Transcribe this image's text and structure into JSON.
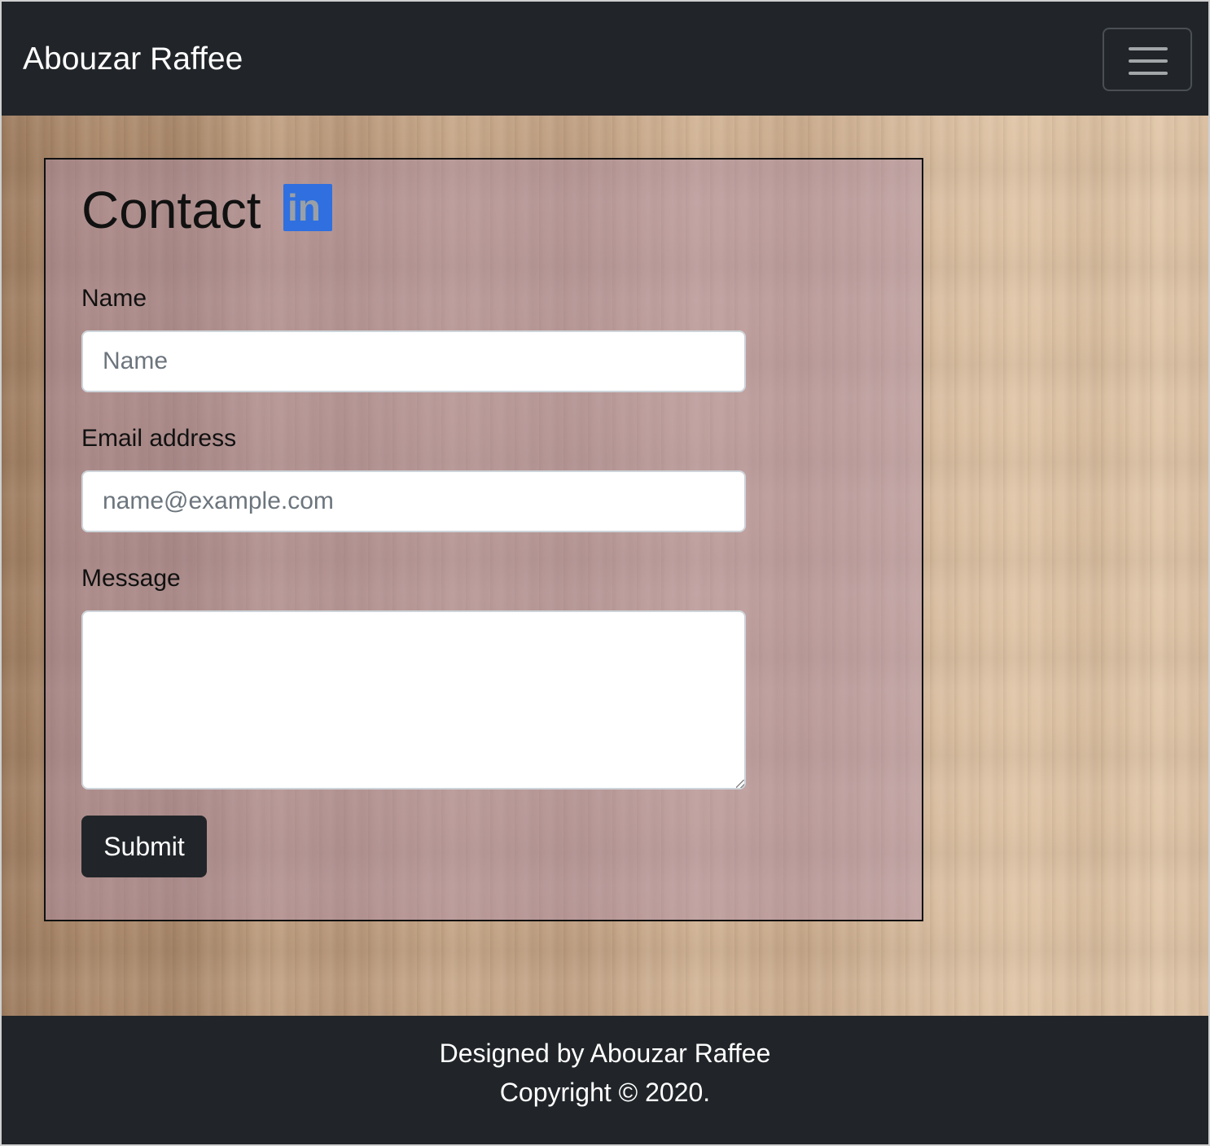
{
  "navbar": {
    "brand": "Abouzar Raffee",
    "menu_toggle_icon": "hamburger-icon"
  },
  "contact": {
    "title": "Contact",
    "linkedin_icon": "linkedin-icon",
    "linkedin_glyph": "in",
    "linkedin_color": "#2f6fe0",
    "name_label": "Name",
    "name_placeholder": "Name",
    "email_label": "Email address",
    "email_placeholder": "name@example.com",
    "message_label": "Message",
    "submit_label": "Submit"
  },
  "footer": {
    "line1": "Designed by Abouzar Raffee",
    "line2": "Copyright © 2020."
  },
  "colors": {
    "navbar_bg": "#212529",
    "button_bg": "#212529"
  }
}
